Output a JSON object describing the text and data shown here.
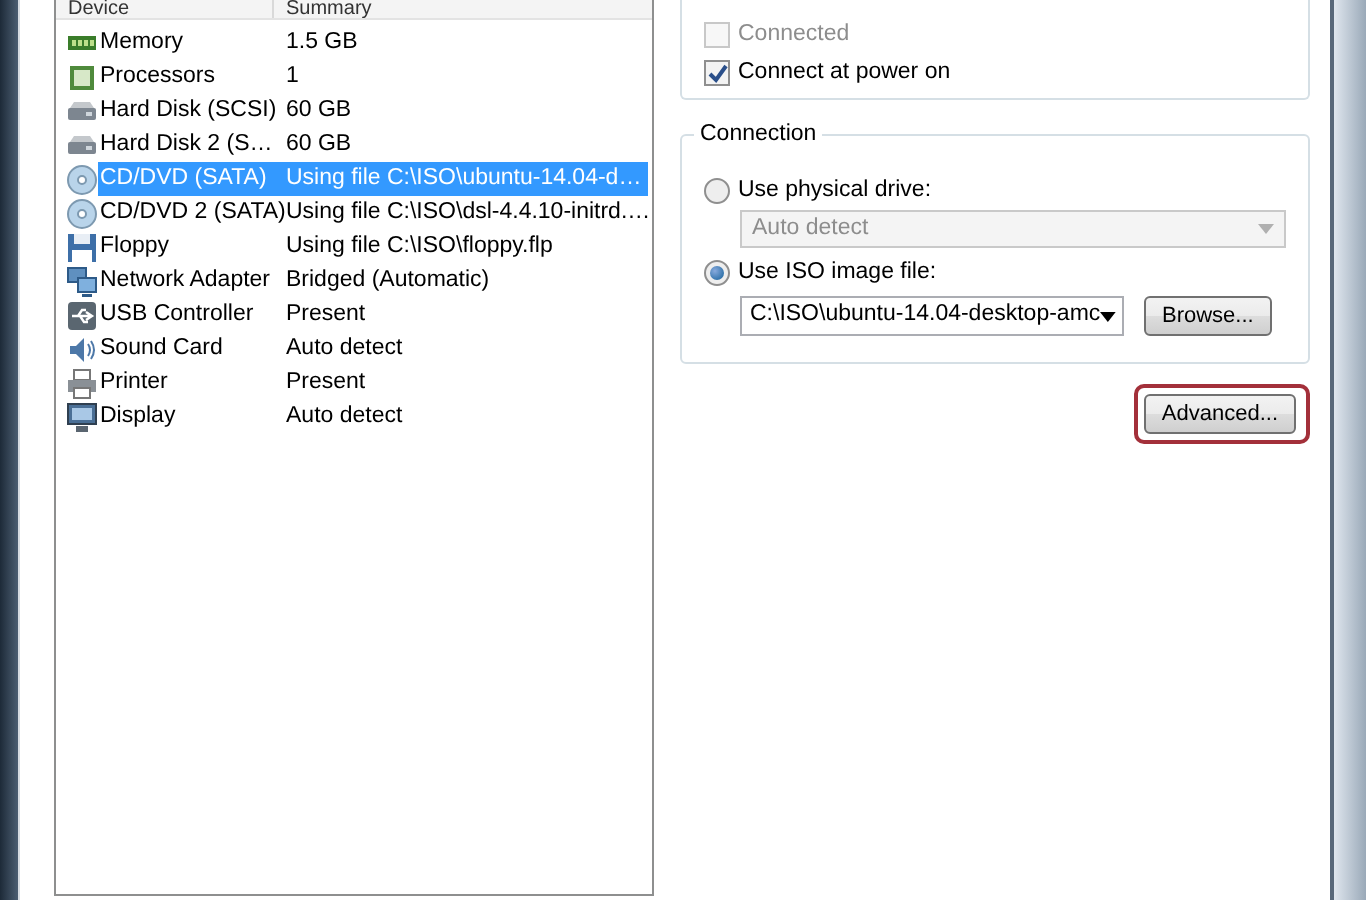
{
  "device_table": {
    "columns": [
      "Device",
      "Summary"
    ],
    "rows": [
      {
        "kind": "memory",
        "device": "Memory",
        "summary": "1.5 GB",
        "selected": false
      },
      {
        "kind": "processor",
        "device": "Processors",
        "summary": "1",
        "selected": false
      },
      {
        "kind": "disk",
        "device": "Hard Disk (SCSI)",
        "summary": "60 GB",
        "selected": false
      },
      {
        "kind": "disk",
        "device": "Hard Disk 2 (S…",
        "summary": "60 GB",
        "selected": false
      },
      {
        "kind": "cd",
        "device": "CD/DVD (SATA)",
        "summary": "Using file C:\\ISO\\ubuntu-14.04-d…",
        "selected": true
      },
      {
        "kind": "cd",
        "device": "CD/DVD 2 (SATA)",
        "summary": "Using file C:\\ISO\\dsl-4.4.10-initrd.…",
        "selected": false
      },
      {
        "kind": "floppy",
        "device": "Floppy",
        "summary": "Using file C:\\ISO\\floppy.flp",
        "selected": false
      },
      {
        "kind": "network",
        "device": "Network Adapter",
        "summary": "Bridged (Automatic)",
        "selected": false
      },
      {
        "kind": "usb",
        "device": "USB Controller",
        "summary": "Present",
        "selected": false
      },
      {
        "kind": "sound",
        "device": "Sound Card",
        "summary": "Auto detect",
        "selected": false
      },
      {
        "kind": "printer",
        "device": "Printer",
        "summary": "Present",
        "selected": false
      },
      {
        "kind": "display",
        "device": "Display",
        "summary": "Auto detect",
        "selected": false
      }
    ]
  },
  "device_status": {
    "options": [
      {
        "label": "Connected",
        "checked": false,
        "disabled": true
      },
      {
        "label": "Connect at power on",
        "checked": true,
        "disabled": false
      }
    ]
  },
  "connection": {
    "title": "Connection",
    "physical_drive": {
      "label": "Use physical drive:",
      "selected": false,
      "value": "Auto detect",
      "disabled": true
    },
    "iso_image": {
      "label": "Use ISO image file:",
      "selected": true,
      "value": "C:\\ISO\\ubuntu-14.04-desktop-amc",
      "browse_button": "Browse..."
    }
  },
  "advanced_button": {
    "label": "Advanced...",
    "highlighted": true
  }
}
